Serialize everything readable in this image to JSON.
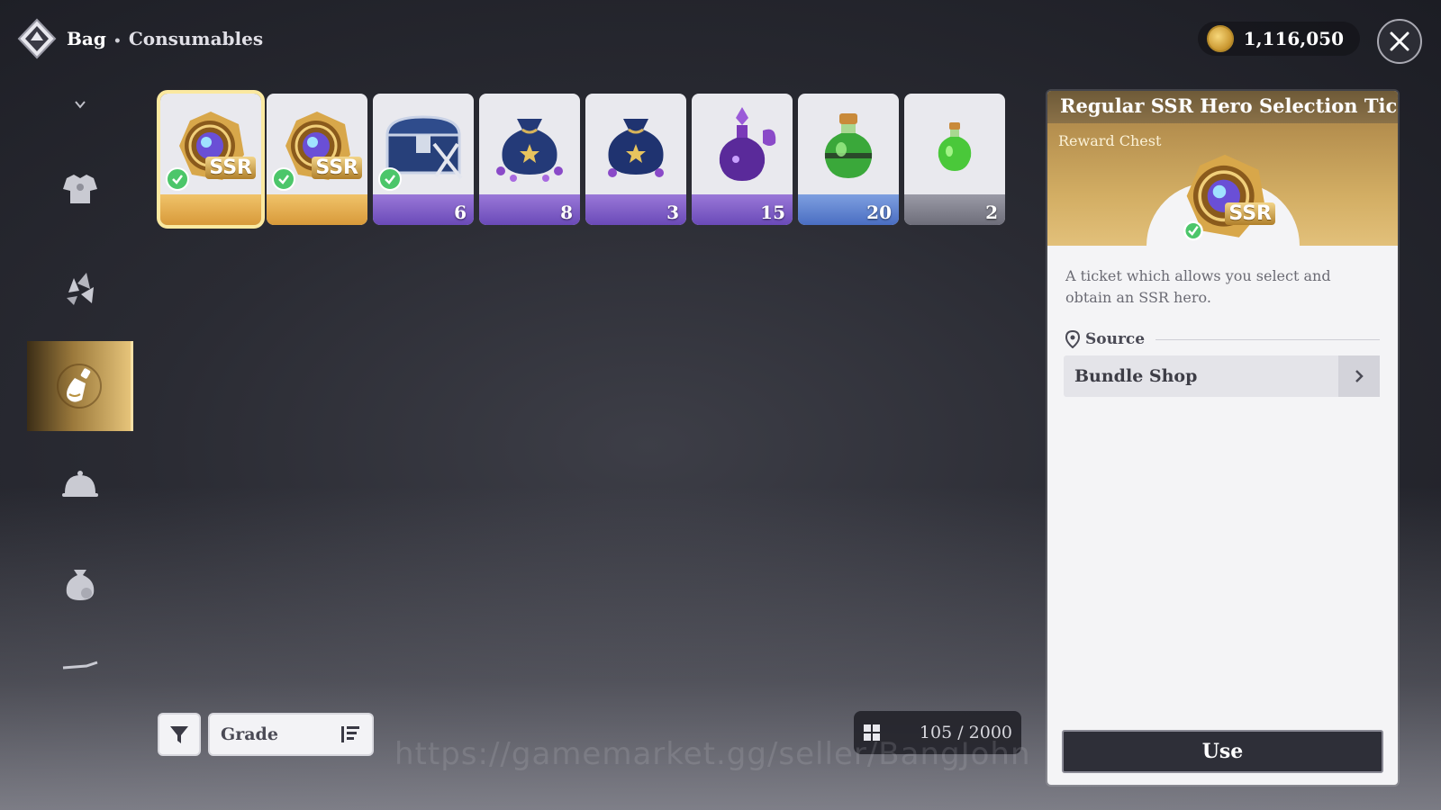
{
  "header": {
    "title": "Bag",
    "separator": "•",
    "subtitle": "Consumables"
  },
  "currency": {
    "icon": "gold-coin-icon",
    "amount": "1,116,050"
  },
  "sidebar": {
    "items": [
      {
        "name": "chevron-down-icon",
        "active": false
      },
      {
        "name": "armor-icon",
        "active": false
      },
      {
        "name": "gem-shards-icon",
        "active": false
      },
      {
        "name": "potion-icon",
        "active": true
      },
      {
        "name": "cloche-icon",
        "active": false
      },
      {
        "name": "pouch-icon",
        "active": false
      },
      {
        "name": "misc-icon",
        "active": false
      }
    ]
  },
  "items": [
    {
      "name": "ssr-ticket",
      "count": "",
      "grade": "gold",
      "checked": true,
      "ssr_label": "SSR",
      "selected": true
    },
    {
      "name": "ssr-ticket",
      "count": "",
      "grade": "gold",
      "checked": true,
      "ssr_label": "SSR",
      "selected": false
    },
    {
      "name": "reward-chest",
      "count": "6",
      "grade": "purple",
      "checked": true,
      "ssr_label": "",
      "selected": false
    },
    {
      "name": "star-pouch",
      "count": "8",
      "grade": "purple",
      "checked": false,
      "ssr_label": "",
      "selected": false
    },
    {
      "name": "star-pouch",
      "count": "3",
      "grade": "purple",
      "checked": false,
      "ssr_label": "",
      "selected": false
    },
    {
      "name": "purple-potion",
      "count": "15",
      "grade": "purple",
      "checked": false,
      "ssr_label": "",
      "selected": false
    },
    {
      "name": "green-potion-large",
      "count": "20",
      "grade": "blue",
      "checked": false,
      "ssr_label": "",
      "selected": false
    },
    {
      "name": "green-potion-small",
      "count": "2",
      "grade": "grey",
      "checked": false,
      "ssr_label": "",
      "selected": false
    }
  ],
  "controls": {
    "sort_label": "Grade",
    "capacity": "105 / 2000"
  },
  "watermark": "https://gamemarket.gg/seller/BangJohn",
  "detail": {
    "title": "Regular SSR Hero Selection Ticket",
    "category": "Reward Chest",
    "ssr_label": "SSR",
    "description": "A ticket which allows you select and obtain an SSR hero.",
    "source_heading": "Source",
    "source_item": "Bundle Shop",
    "use_label": "Use"
  },
  "colors": {
    "gold": "#e2b85c",
    "purple": "#7a5ac8",
    "blue": "#5a7ed0",
    "grey": "#7c7c88",
    "check": "#4cc66a"
  }
}
